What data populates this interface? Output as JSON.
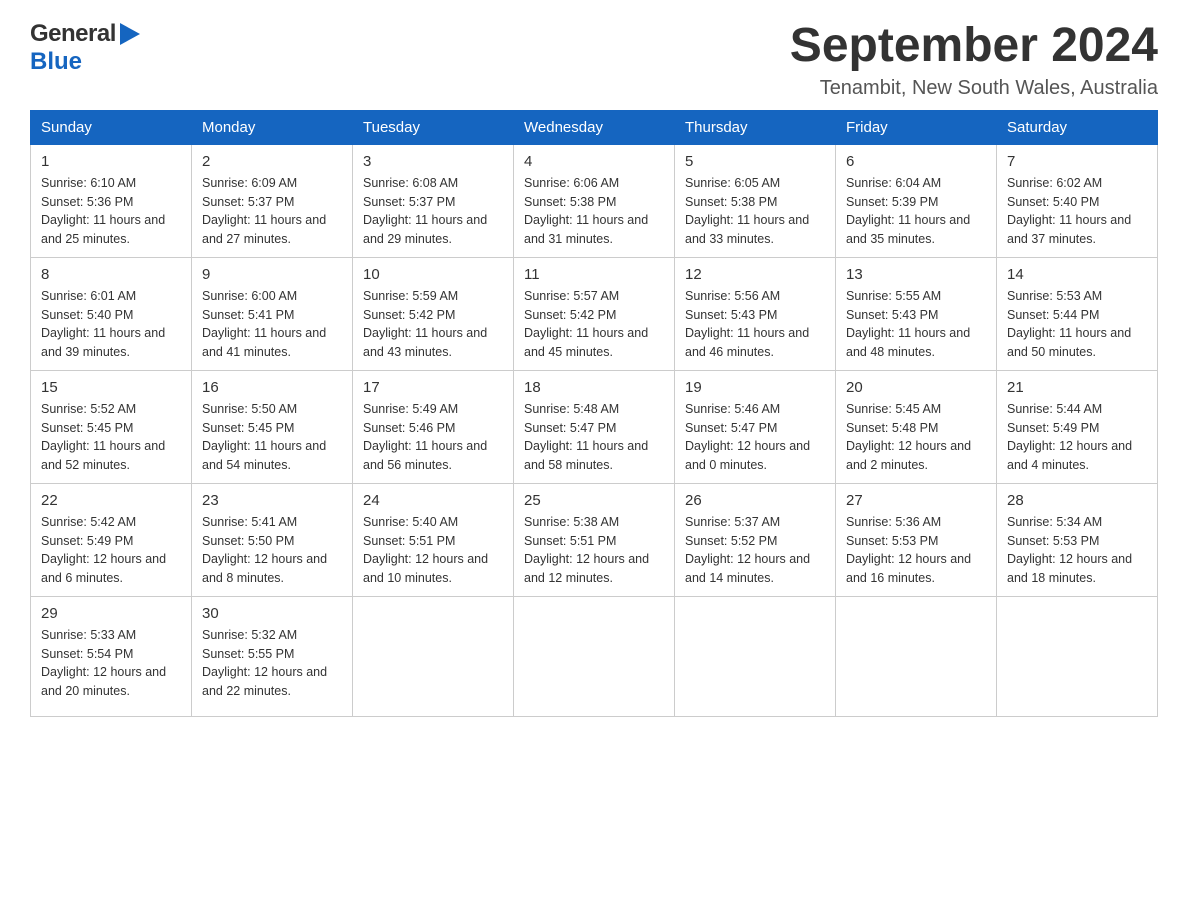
{
  "header": {
    "logo_general": "General",
    "logo_blue": "Blue",
    "month_year": "September 2024",
    "location": "Tenambit, New South Wales, Australia"
  },
  "days_of_week": [
    "Sunday",
    "Monday",
    "Tuesday",
    "Wednesday",
    "Thursday",
    "Friday",
    "Saturday"
  ],
  "weeks": [
    [
      {
        "day": "1",
        "sunrise": "6:10 AM",
        "sunset": "5:36 PM",
        "daylight": "11 hours and 25 minutes."
      },
      {
        "day": "2",
        "sunrise": "6:09 AM",
        "sunset": "5:37 PM",
        "daylight": "11 hours and 27 minutes."
      },
      {
        "day": "3",
        "sunrise": "6:08 AM",
        "sunset": "5:37 PM",
        "daylight": "11 hours and 29 minutes."
      },
      {
        "day": "4",
        "sunrise": "6:06 AM",
        "sunset": "5:38 PM",
        "daylight": "11 hours and 31 minutes."
      },
      {
        "day": "5",
        "sunrise": "6:05 AM",
        "sunset": "5:38 PM",
        "daylight": "11 hours and 33 minutes."
      },
      {
        "day": "6",
        "sunrise": "6:04 AM",
        "sunset": "5:39 PM",
        "daylight": "11 hours and 35 minutes."
      },
      {
        "day": "7",
        "sunrise": "6:02 AM",
        "sunset": "5:40 PM",
        "daylight": "11 hours and 37 minutes."
      }
    ],
    [
      {
        "day": "8",
        "sunrise": "6:01 AM",
        "sunset": "5:40 PM",
        "daylight": "11 hours and 39 minutes."
      },
      {
        "day": "9",
        "sunrise": "6:00 AM",
        "sunset": "5:41 PM",
        "daylight": "11 hours and 41 minutes."
      },
      {
        "day": "10",
        "sunrise": "5:59 AM",
        "sunset": "5:42 PM",
        "daylight": "11 hours and 43 minutes."
      },
      {
        "day": "11",
        "sunrise": "5:57 AM",
        "sunset": "5:42 PM",
        "daylight": "11 hours and 45 minutes."
      },
      {
        "day": "12",
        "sunrise": "5:56 AM",
        "sunset": "5:43 PM",
        "daylight": "11 hours and 46 minutes."
      },
      {
        "day": "13",
        "sunrise": "5:55 AM",
        "sunset": "5:43 PM",
        "daylight": "11 hours and 48 minutes."
      },
      {
        "day": "14",
        "sunrise": "5:53 AM",
        "sunset": "5:44 PM",
        "daylight": "11 hours and 50 minutes."
      }
    ],
    [
      {
        "day": "15",
        "sunrise": "5:52 AM",
        "sunset": "5:45 PM",
        "daylight": "11 hours and 52 minutes."
      },
      {
        "day": "16",
        "sunrise": "5:50 AM",
        "sunset": "5:45 PM",
        "daylight": "11 hours and 54 minutes."
      },
      {
        "day": "17",
        "sunrise": "5:49 AM",
        "sunset": "5:46 PM",
        "daylight": "11 hours and 56 minutes."
      },
      {
        "day": "18",
        "sunrise": "5:48 AM",
        "sunset": "5:47 PM",
        "daylight": "11 hours and 58 minutes."
      },
      {
        "day": "19",
        "sunrise": "5:46 AM",
        "sunset": "5:47 PM",
        "daylight": "12 hours and 0 minutes."
      },
      {
        "day": "20",
        "sunrise": "5:45 AM",
        "sunset": "5:48 PM",
        "daylight": "12 hours and 2 minutes."
      },
      {
        "day": "21",
        "sunrise": "5:44 AM",
        "sunset": "5:49 PM",
        "daylight": "12 hours and 4 minutes."
      }
    ],
    [
      {
        "day": "22",
        "sunrise": "5:42 AM",
        "sunset": "5:49 PM",
        "daylight": "12 hours and 6 minutes."
      },
      {
        "day": "23",
        "sunrise": "5:41 AM",
        "sunset": "5:50 PM",
        "daylight": "12 hours and 8 minutes."
      },
      {
        "day": "24",
        "sunrise": "5:40 AM",
        "sunset": "5:51 PM",
        "daylight": "12 hours and 10 minutes."
      },
      {
        "day": "25",
        "sunrise": "5:38 AM",
        "sunset": "5:51 PM",
        "daylight": "12 hours and 12 minutes."
      },
      {
        "day": "26",
        "sunrise": "5:37 AM",
        "sunset": "5:52 PM",
        "daylight": "12 hours and 14 minutes."
      },
      {
        "day": "27",
        "sunrise": "5:36 AM",
        "sunset": "5:53 PM",
        "daylight": "12 hours and 16 minutes."
      },
      {
        "day": "28",
        "sunrise": "5:34 AM",
        "sunset": "5:53 PM",
        "daylight": "12 hours and 18 minutes."
      }
    ],
    [
      {
        "day": "29",
        "sunrise": "5:33 AM",
        "sunset": "5:54 PM",
        "daylight": "12 hours and 20 minutes."
      },
      {
        "day": "30",
        "sunrise": "5:32 AM",
        "sunset": "5:55 PM",
        "daylight": "12 hours and 22 minutes."
      },
      null,
      null,
      null,
      null,
      null
    ]
  ],
  "labels": {
    "sunrise": "Sunrise:",
    "sunset": "Sunset:",
    "daylight": "Daylight:"
  }
}
